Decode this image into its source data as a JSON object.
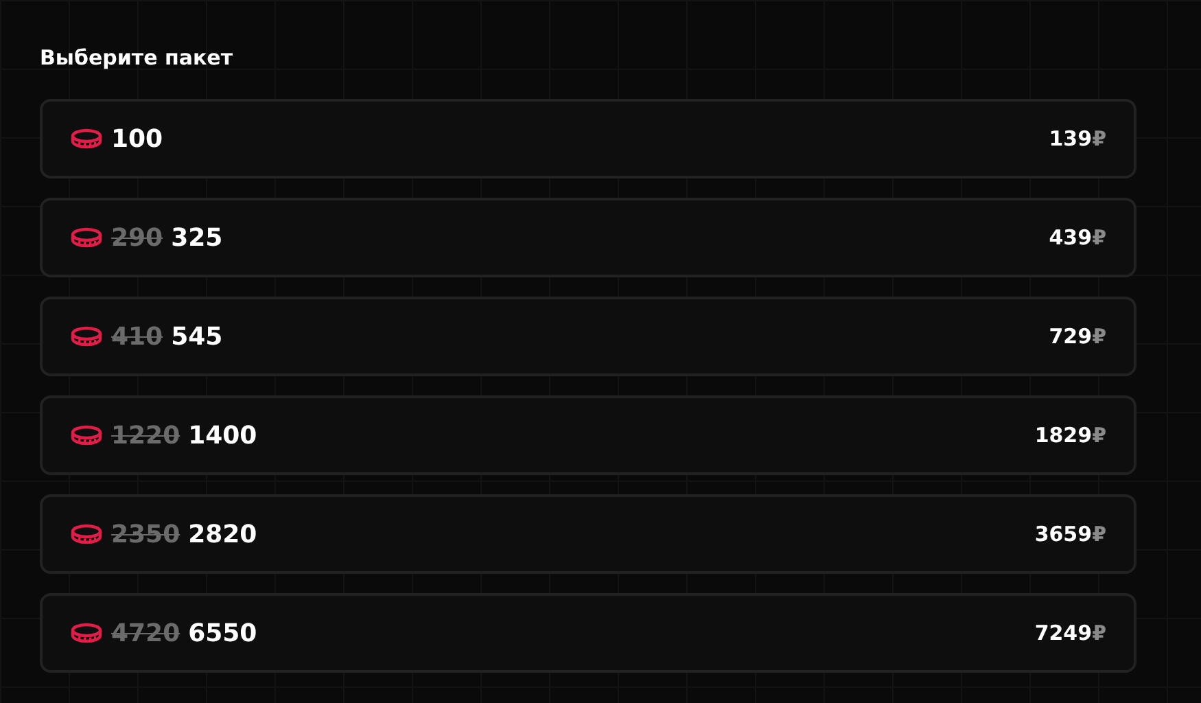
{
  "title": "Выберите пакет",
  "packages": [
    {
      "amount": "100",
      "price": "139",
      "currency": "₽"
    },
    {
      "old_amount": "290",
      "amount": "325",
      "price": "439",
      "currency": "₽"
    },
    {
      "old_amount": "410",
      "amount": "545",
      "price": "729",
      "currency": "₽"
    },
    {
      "old_amount": "1220",
      "amount": "1400",
      "price": "1829",
      "currency": "₽"
    },
    {
      "old_amount": "2350",
      "amount": "2820",
      "price": "3659",
      "currency": "₽"
    },
    {
      "old_amount": "4720",
      "amount": "6550",
      "price": "7249",
      "currency": "₽"
    }
  ]
}
